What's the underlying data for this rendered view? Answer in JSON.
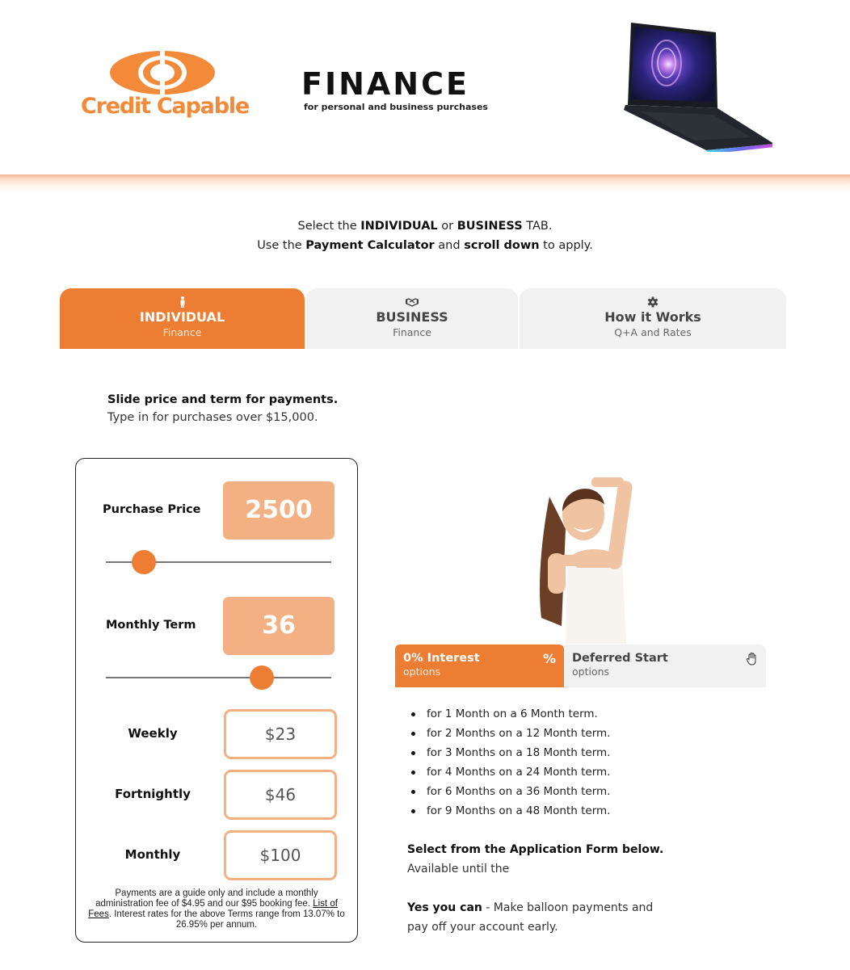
{
  "header": {
    "brand_name": "Credit Capable",
    "title": "FINANCE",
    "subtitle": "for personal and business purchases",
    "product_image": "laptop-image",
    "accent_color": "#ed7d32"
  },
  "intro": {
    "line1": {
      "part1": "Select the ",
      "bold1": "INDIVIDUAL",
      "part2": " or ",
      "bold2": "BUSINESS",
      "part3": " TAB."
    },
    "line2": {
      "part1": "Use the ",
      "bold1": "Payment Calculator",
      "part2": " and ",
      "bold2": "scroll down",
      "part3": " to apply."
    }
  },
  "tabs": [
    {
      "icon": "person-icon",
      "title": "INDIVIDUAL",
      "subtitle": "Finance",
      "active": true
    },
    {
      "icon": "handshake-icon",
      "title": "BUSINESS",
      "subtitle": "Finance",
      "active": false
    },
    {
      "icon": "gear-icon",
      "title": "How it Works",
      "subtitle": "Q+A and Rates",
      "active": false
    }
  ],
  "calculator": {
    "instruction_bold": "Slide price and term for payments.",
    "instruction": "Type in for purchases over $15,000.",
    "purchase_price": {
      "label": "Purchase Price",
      "value": "2500",
      "slider_fraction": 0.17
    },
    "monthly_term": {
      "label": "Monthly Term",
      "value": "36",
      "slider_fraction": 0.69
    },
    "payments": [
      {
        "label": "Weekly",
        "amount": "$23"
      },
      {
        "label": "Fortnightly",
        "amount": "$46"
      },
      {
        "label": "Monthly",
        "amount": "$100"
      }
    ],
    "fine_print": {
      "before_link": "Payments are a guide only and include a monthly administration fee of $4.95 and our $95 booking fee. ",
      "link": "List of Fees",
      "after_link": ". Interest rates for the above Terms range from 13.07% to 26.95% per annum."
    }
  },
  "options": {
    "photo": "woman-framing-gesture-photo",
    "tabs": [
      {
        "title": "0% Interest",
        "subtitle": "options",
        "icon": "percent-icon",
        "icon_glyph": "%",
        "active": true
      },
      {
        "title": "Deferred Start",
        "subtitle": "options",
        "icon": "hand-icon",
        "active": false
      }
    ],
    "terms": [
      "for 1 Month on a 6 Month term.",
      "for 2 Months on a 12 Month term.",
      "for 3 Months on a 18 Month term.",
      "for 4 Months on a 24 Month term.",
      "for 6 Months on a 36 Month term.",
      "for 9 Months on a 48 Month term."
    ],
    "apply_heading": "Select from the Application Form below.",
    "available_until": "Available until the",
    "balloon_bold": "Yes you can",
    "balloon_text": " - Make balloon payments and pay off your account early."
  }
}
